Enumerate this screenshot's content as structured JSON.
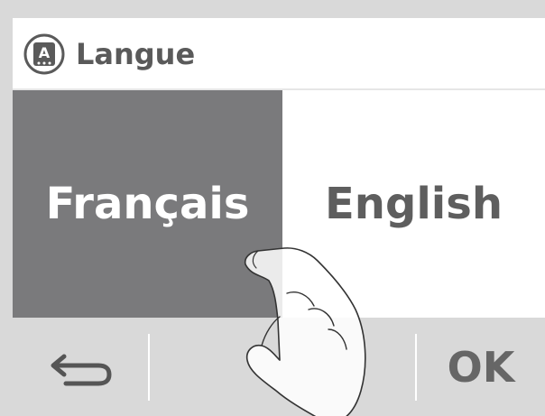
{
  "header": {
    "title": "Langue",
    "icon": "language-icon",
    "icon_letter": "A"
  },
  "languages": {
    "french": "Français",
    "english": "English",
    "selected": "Français"
  },
  "footer": {
    "back_icon": "return-arrow-icon",
    "ok_label": "OK"
  },
  "overlay": {
    "hand_icon": "pointing-hand-icon"
  },
  "colors": {
    "selected_bg": "#7a7a7c",
    "unselected_bg": "#ffffff",
    "footer_bg": "#d9d9d9",
    "text_dark": "#5e5e5e"
  }
}
